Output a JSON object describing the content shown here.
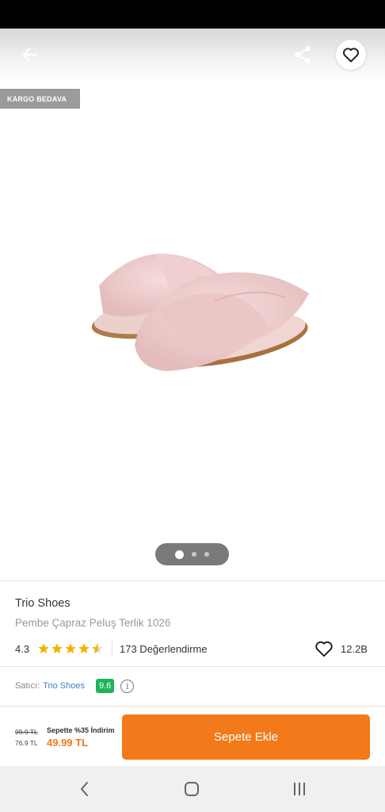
{
  "badge": {
    "label": "KARGO BEDAVA"
  },
  "carousel": {
    "total": 3,
    "active": 1
  },
  "product": {
    "brand": "Trio Shoes",
    "name": "Pembe Çapraz Peluş Terlik 1026",
    "rating": "4.3",
    "rating_value": 4.3,
    "rating_max": 5,
    "review_count": "173 Değerlendirme",
    "favorites": "12.2B"
  },
  "seller": {
    "label": "Satıcı:",
    "name": "Trio Shoes",
    "score": "9.6"
  },
  "pricing": {
    "old_price": "99.9 TL",
    "current_price": "76.9 TL",
    "promo_label": "Sepette %35 İndirim",
    "discount_price": "49.99 TL"
  },
  "actions": {
    "add_to_cart": "Sepete Ekle"
  },
  "icons": {
    "back": "arrow-left-icon",
    "share": "share-icon",
    "favorite": "heart-outline-icon",
    "info": "info-icon",
    "nav_back": "chevron-left-icon",
    "nav_home": "home-square-icon",
    "nav_recents": "recents-bars-icon"
  },
  "colors": {
    "accent": "#f27a1a",
    "seller_score": "#1fb35a",
    "star": "#f5b301",
    "link": "#3d7dbd"
  }
}
